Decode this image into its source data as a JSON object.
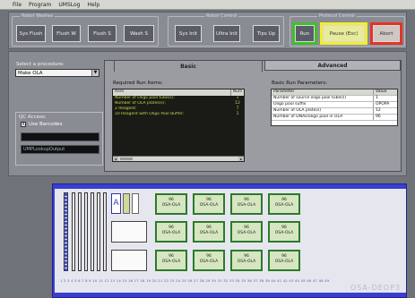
{
  "menu": [
    "File",
    "Program",
    "UMSLog",
    "Help"
  ],
  "groups": {
    "robot_wash": "Robot Washes",
    "robot_control": "Robot Control",
    "protocol_control": "Protocol Control"
  },
  "buttons": {
    "sys_flush": "Sys Flush",
    "flush_w": "Flush W",
    "flush_s": "Flush S",
    "wash_s": "Wash S",
    "sys_init": "Sys Init",
    "ultra_init": "Ultra Init",
    "tips_up": "Tips Up",
    "run": "Run",
    "pause": "Pause (Esc)",
    "abort": "Abort"
  },
  "procedure": {
    "label": "Select a procedure:",
    "value": "Make OLA"
  },
  "qc": {
    "label": "QC Access:",
    "checkbox": "Use Barcodes",
    "checkbox_state": "X",
    "field1": "",
    "field2": "UMPLookupOutput"
  },
  "tabs": {
    "basic": "Basic",
    "advanced": "Advanced"
  },
  "required_items": {
    "title": "Required Run Items:",
    "col_item": "Item",
    "col_num": "Num",
    "rows": [
      {
        "item": "Number of Oligo pool tube(s):",
        "num": "1"
      },
      {
        "item": "Number of OLA plates(s):",
        "num": "12"
      },
      {
        "item": "2 Reagent:",
        "num": "7"
      },
      {
        "item": "10 Reagent with Oligo Pool Buffer:",
        "num": "1"
      }
    ]
  },
  "basic_params": {
    "title": "Basic Run Parameters:",
    "col_param": "Parameter",
    "col_value": "Value",
    "rows": [
      {
        "param": "Number of source oligo pool tube(s)",
        "value": "1"
      },
      {
        "param": "Oligo pool suffix",
        "value": "OPOPA"
      },
      {
        "param": "Number of OLA plate(s)",
        "value": "12"
      },
      {
        "param": "Number of DNAs/oligo pool in OLA",
        "value": "96"
      }
    ]
  },
  "deck": {
    "letter_a": "A",
    "plate_count_label": "96",
    "plate_label": "OSA-OLA",
    "ruler": "1 2 3 4 5 6 7 8 9 10 11 12 13 14 15 16 17 18 19 20 21 22 23 24 25 26 27 28 29 30 31 32 33 34 35 36 37 38 39 40 41 42 43 44 45 46 47 48 49 50 51 52 53 54 55 56 57 58 59 60 61 62 63 64 65 66 67",
    "watermark": "OSA-DEOP3"
  }
}
